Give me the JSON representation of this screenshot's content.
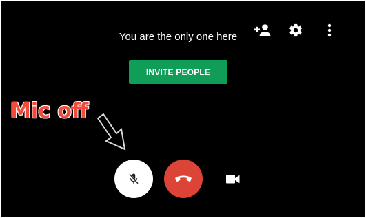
{
  "call": {
    "status_text": "You are the only one here",
    "invite_label": "INVITE PEOPLE"
  },
  "annotation": {
    "label": "Mic off"
  },
  "toolbar": {
    "icons": [
      "add-person-icon",
      "settings-icon",
      "more-vert-icon"
    ]
  },
  "controls": {
    "icons": [
      "mic-off-icon",
      "hang-up-icon",
      "camera-icon"
    ]
  },
  "colors": {
    "background": "#000000",
    "invite_button": "#0f9d58",
    "hangup_button": "#db4437",
    "annotation_text": "#f44a3a",
    "mic_button": "#ffffff"
  }
}
